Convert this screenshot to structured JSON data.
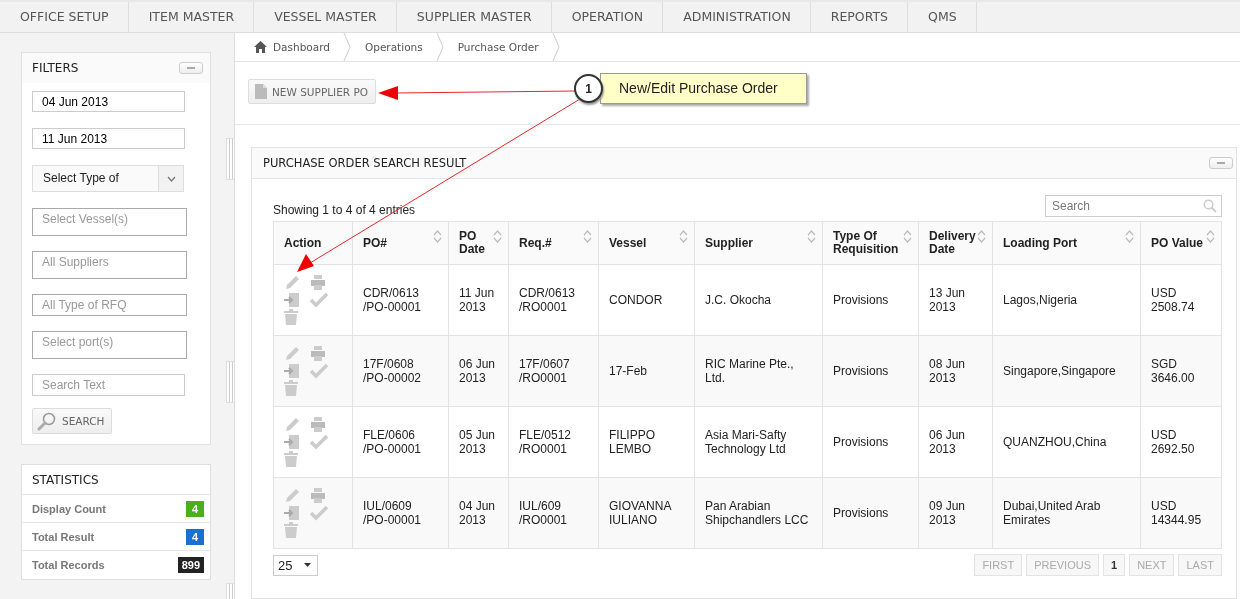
{
  "nav": [
    {
      "label": "OFFICE SETUP"
    },
    {
      "label": "ITEM MASTER"
    },
    {
      "label": "VESSEL MASTER"
    },
    {
      "label": "SUPPLIER MASTER"
    },
    {
      "label": "OPERATION"
    },
    {
      "label": "ADMINISTRATION"
    },
    {
      "label": "REPORTS"
    },
    {
      "label": "QMS"
    }
  ],
  "filters": {
    "title": "FILTERS",
    "fields": [
      {
        "kind": "date",
        "value": "04 Jun 2013"
      },
      {
        "kind": "date",
        "value": "11 Jun 2013"
      },
      {
        "kind": "select",
        "value": "Select Type of"
      },
      {
        "kind": "multi",
        "placeholder": "Select Vessel(s)"
      },
      {
        "kind": "multi",
        "placeholder": "All Suppliers"
      },
      {
        "kind": "text",
        "placeholder": "All Type of RFQ"
      },
      {
        "kind": "multi",
        "placeholder": "Select port(s)"
      },
      {
        "kind": "text",
        "placeholder": "Search Text"
      }
    ],
    "search_button": "SEARCH"
  },
  "statistics": {
    "title": "STATISTICS",
    "items": [
      {
        "label": "Display Count",
        "value": "4",
        "color": "#4cae1a"
      },
      {
        "label": "Total Result",
        "value": "4",
        "color": "#1a6fd0"
      },
      {
        "label": "Total Records",
        "value": "899",
        "color": "#222222"
      }
    ]
  },
  "breadcrumb": [
    "Dashboard",
    "Operations",
    "Purchase Order"
  ],
  "new_button": "NEW SUPPLIER PO",
  "callout": {
    "number": "1",
    "text": "New/Edit Purchase Order"
  },
  "results": {
    "title": "PURCHASE ORDER SEARCH RESULT",
    "info": "Showing 1 to 4 of 4 entries",
    "search_placeholder": "Search",
    "columns": [
      {
        "label": "Action",
        "sortable": false
      },
      {
        "label": "PO#",
        "sortable": true
      },
      {
        "label": "PO Date",
        "sortable": true
      },
      {
        "label": "Req.#",
        "sortable": true
      },
      {
        "label": "Vessel",
        "sortable": true
      },
      {
        "label": "Supplier",
        "sortable": true
      },
      {
        "label": "Type Of Requisition",
        "sortable": true
      },
      {
        "label": "Delivery Date",
        "sortable": true
      },
      {
        "label": "Loading Port",
        "sortable": true
      },
      {
        "label": "PO Value",
        "sortable": true
      }
    ],
    "rows": [
      {
        "po": "CDR/0613 /PO-00001",
        "po_date": "11 Jun 2013",
        "req": "CDR/0613 /RO0001",
        "vessel": "CONDOR",
        "supplier": "J.C. Okocha",
        "type": "Provisions",
        "delivery": "13 Jun 2013",
        "port": "Lagos,Nigeria",
        "value": "USD 2508.74"
      },
      {
        "po": "17F/0608 /PO-00002",
        "po_date": "06 Jun 2013",
        "req": "17F/0607 /RO0001",
        "vessel": "17-Feb",
        "supplier": "RIC Marine Pte., Ltd.",
        "type": "Provisions",
        "delivery": "08 Jun 2013",
        "port": "Singapore,Singapore",
        "value": "SGD 3646.00"
      },
      {
        "po": "FLE/0606 /PO-00001",
        "po_date": "05 Jun 2013",
        "req": "FLE/0512 /RO0001",
        "vessel": "FILIPPO LEMBO",
        "supplier": "Asia Mari-Safty Technology Ltd",
        "type": "Provisions",
        "delivery": "06 Jun 2013",
        "port": "QUANZHOU,China",
        "value": "USD 2692.50"
      },
      {
        "po": "IUL/0609 /PO-00001",
        "po_date": "04 Jun 2013",
        "req": "IUL/609 /RO0001",
        "vessel": "GIOVANNA IULIANO",
        "supplier": "Pan Arabian Shipchandlers LCC",
        "type": "Provisions",
        "delivery": "09 Jun 2013",
        "port": "Dubai,United Arab Emirates",
        "value": "USD 14344.95"
      }
    ],
    "page_size": "25",
    "pager": [
      {
        "label": "FIRST",
        "disabled": true
      },
      {
        "label": "PREVIOUS",
        "disabled": true
      },
      {
        "label": "1",
        "disabled": false
      },
      {
        "label": "NEXT",
        "disabled": true
      },
      {
        "label": "LAST",
        "disabled": true
      }
    ]
  }
}
